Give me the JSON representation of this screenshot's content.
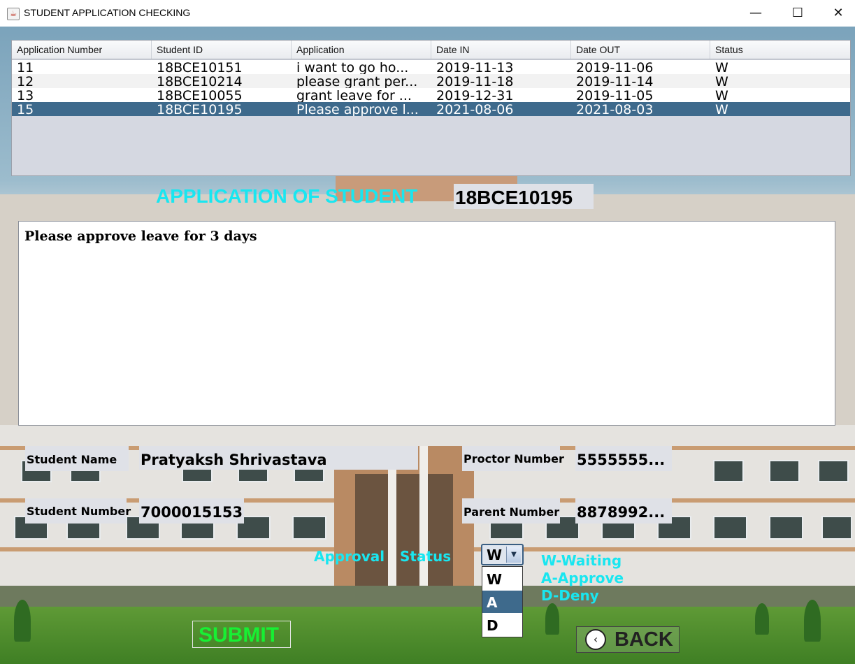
{
  "window": {
    "title": "STUDENT APPLICATION CHECKING",
    "minimize": "—",
    "maximize": "☐",
    "close": "✕"
  },
  "table": {
    "columns": [
      "Application Number",
      "Student ID",
      "Application",
      "Date IN",
      "Date OUT",
      "Status"
    ],
    "rows": [
      [
        "11",
        "18BCE10151",
        "i want to go ho...",
        "2019-11-13",
        "2019-11-06",
        "W"
      ],
      [
        "12",
        "18BCE10214",
        "please grant per...",
        "2019-11-18",
        "2019-11-14",
        "W"
      ],
      [
        "13",
        "18BCE10055",
        "grant leave for ...",
        "2019-12-31",
        "2019-11-05",
        "W"
      ],
      [
        "15",
        "18BCE10195",
        "Please approve l...",
        "2021-08-06",
        "2021-08-03",
        "W"
      ]
    ],
    "selected_row": 3
  },
  "heading": {
    "label": "APPLICATION OF STUDENT",
    "student_id": "18BCE10195"
  },
  "application_text": "Please approve leave for 3 days",
  "fields": {
    "student_name_label": "Student Name",
    "student_name": "Pratyaksh Shrivastava",
    "student_number_label": "Student Number",
    "student_number": "7000015153",
    "proctor_number_label": "Proctor Number",
    "proctor_number": "5555555...",
    "parent_number_label": "Parent Number",
    "parent_number": "8878992..."
  },
  "approval": {
    "label_1": "Approval",
    "label_2": "Status",
    "selected": "W",
    "options": [
      "W",
      "A",
      "D"
    ],
    "highlighted_option": "A",
    "legend": [
      "W-Waiting",
      "A-Approve",
      "D-Deny"
    ]
  },
  "buttons": {
    "submit": "SUBMIT",
    "back": "BACK"
  },
  "colors": {
    "accent_cyan": "#19e6f0",
    "submit_green": "#17f033",
    "selection_blue": "#3e6a8c"
  }
}
